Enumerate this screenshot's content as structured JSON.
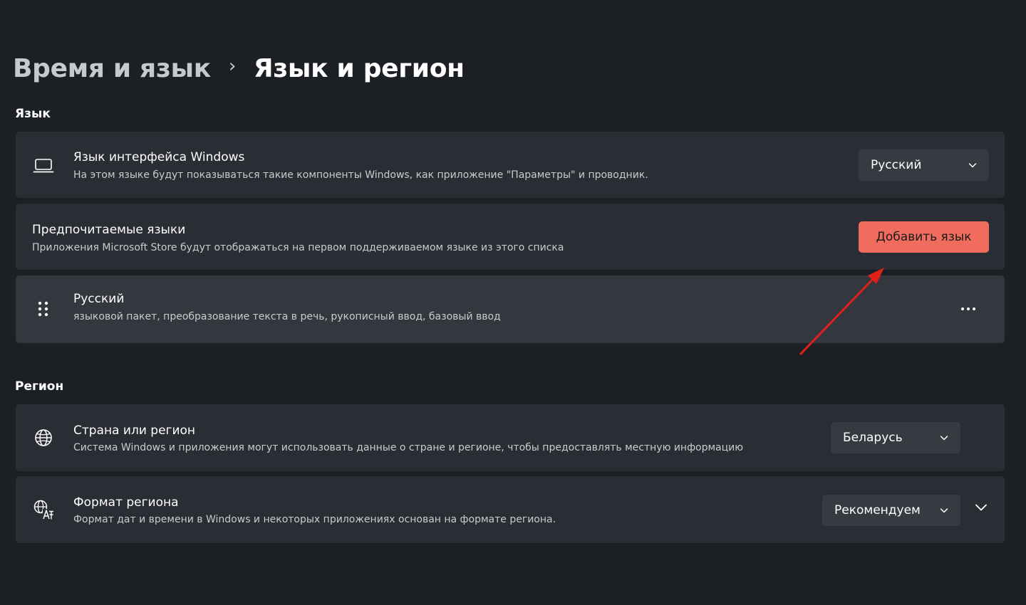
{
  "breadcrumb": {
    "parent": "Время и язык",
    "separator": "›",
    "current": "Язык и регион"
  },
  "language_section": {
    "title": "Язык",
    "display_language": {
      "icon": "laptop-icon",
      "title": "Язык интерфейса Windows",
      "description": "На этом языке будут показываться такие компоненты Windows, как приложение \"Параметры\" и проводник.",
      "value": "Русский"
    },
    "preferred_languages": {
      "title": "Предпочитаемые языки",
      "description": "Приложения Microsoft Store будут отображаться на первом поддерживаемом языке из этого списка",
      "add_button_label": "Добавить язык"
    },
    "languages": [
      {
        "icon": "drag-handle-icon",
        "name": "Русский",
        "features": "языковой пакет, преобразование текста в речь, рукописный ввод, базовый ввод"
      }
    ]
  },
  "region_section": {
    "title": "Регион",
    "country": {
      "icon": "globe-icon",
      "title": "Страна или регион",
      "description": "Система Windows и приложения могут использовать данные о стране и регионе, чтобы предоставлять местную информацию",
      "value": "Беларусь"
    },
    "format": {
      "icon": "language-format-icon",
      "title": "Формат региона",
      "description": "Формат дат и времени в Windows и некоторых приложениях основан на формате региона.",
      "value": "Рекомендуем"
    }
  },
  "colors": {
    "background": "#1c1f24",
    "card": "#2a2d33",
    "accent_button": "#f06d5e",
    "annotation_arrow": "#e0201a"
  }
}
